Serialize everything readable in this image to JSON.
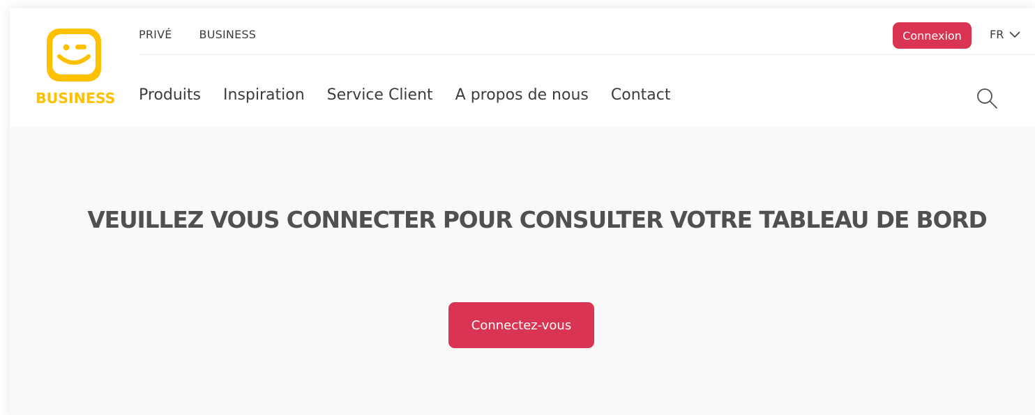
{
  "brand": {
    "logo_text": "BUSINESS",
    "logo_color": "#ffc000",
    "icon": "winking-smiley-icon"
  },
  "topnav": {
    "items": [
      "PRIVÉ",
      "BUSINESS"
    ]
  },
  "header_actions": {
    "login_label": "Connexion",
    "language": "FR",
    "language_icon": "chevron-down-icon",
    "accent_color": "#d93451"
  },
  "mainnav": {
    "items": [
      "Produits",
      "Inspiration",
      "Service Client",
      "A propos de nous",
      "Contact"
    ],
    "search_icon": "search-icon"
  },
  "main": {
    "headline": "VEUILLEZ VOUS CONNECTER POUR CONSULTER VOTRE TABLEAU DE BORD",
    "cta_label": "Connectez-vous"
  }
}
